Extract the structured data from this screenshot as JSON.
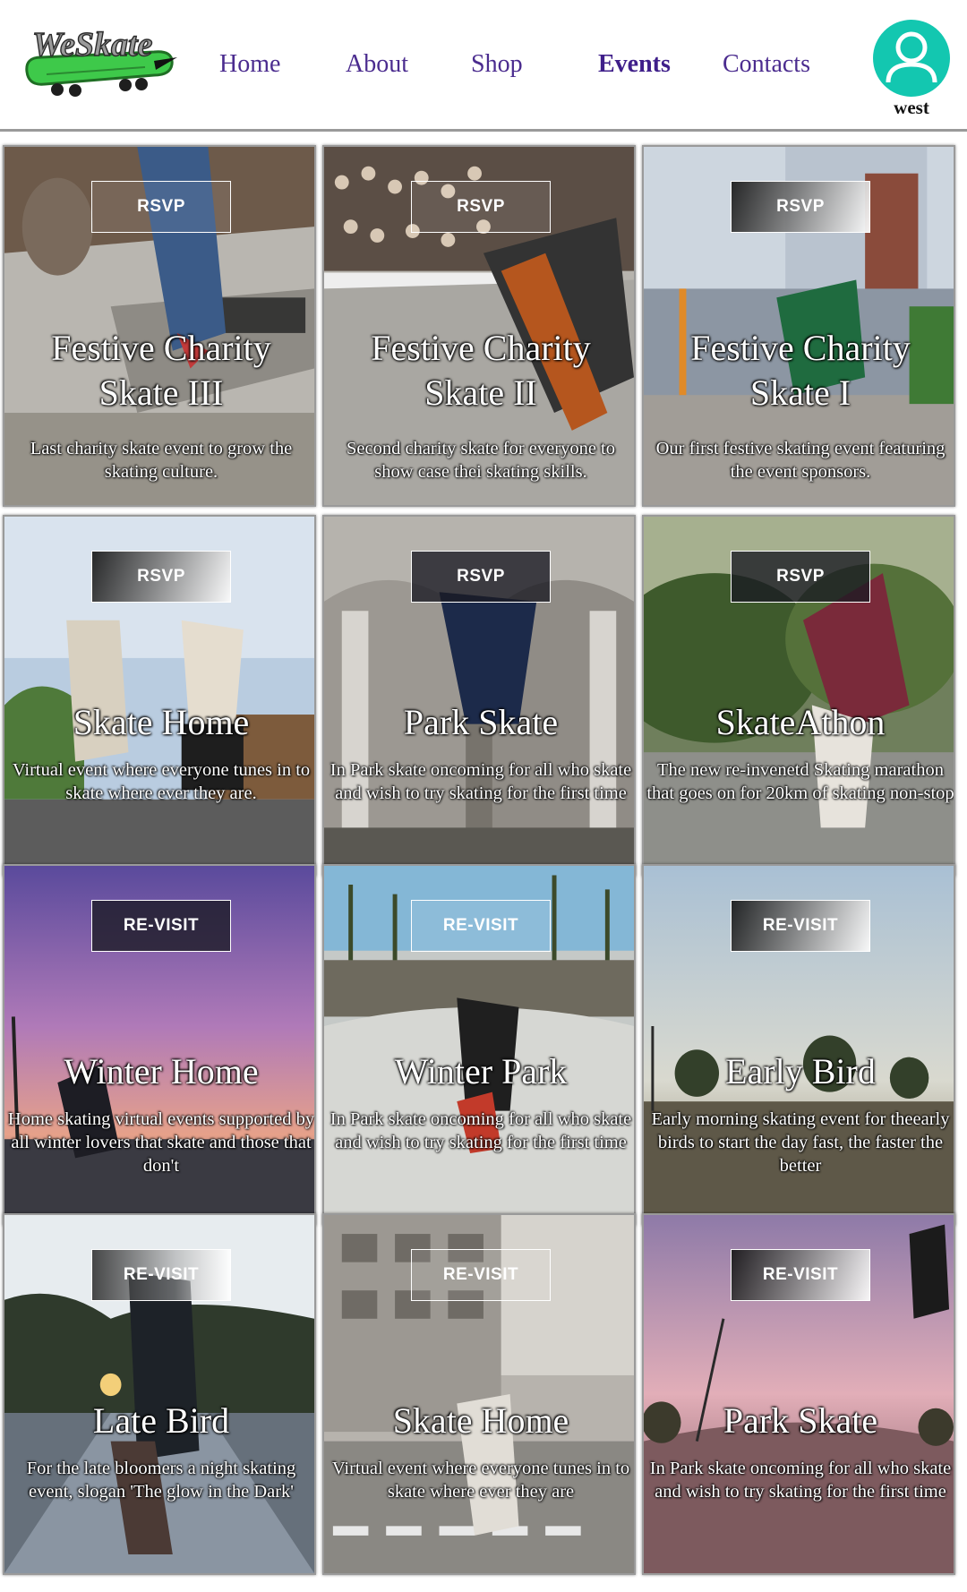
{
  "header": {
    "logo_text": "WeSkate",
    "nav": [
      {
        "label": "Home",
        "active": false
      },
      {
        "label": "About",
        "active": false
      },
      {
        "label": "Shop",
        "active": false
      },
      {
        "label": "Events",
        "active": true
      },
      {
        "label": "Contacts",
        "active": false
      }
    ],
    "user": {
      "icon": "user-icon",
      "name": "west",
      "accent": "#13c7b0"
    }
  },
  "colors": {
    "nav_text": "#4b2c8f",
    "header_rule": "#9a9a9a"
  },
  "events": [
    {
      "button": "RSVP",
      "title": "Festive Charity Skate III",
      "description": "Last charity skate event to grow the skating culture.",
      "scene": "skatepark-concrete"
    },
    {
      "button": "RSVP",
      "title": "Festive Charity Skate II",
      "description": "Second charity skate for everyone to show case thei skating skills.",
      "scene": "vans-bowl-crowd"
    },
    {
      "button": "RSVP",
      "title": "Festive Charity Skate I",
      "description": "Our first festive skating event featuring the event sponsors.",
      "scene": "city-gate"
    },
    {
      "button": "RSVP",
      "title": "Skate Home",
      "description": "Virtual event where everyone tunes in to skate where ever they are.",
      "scene": "sky-jump"
    },
    {
      "button": "RSVP",
      "title": "Park Skate",
      "description": "In Park skate oncoming for all who skate and wish to try skating for the first time",
      "scene": "underpass"
    },
    {
      "button": "RSVP",
      "title": "SkateAthon",
      "description": "The new re-invenetd Skating marathon that goes on for 20km of skating non-stop",
      "scene": "trees-street"
    },
    {
      "button": "RE-VISIT",
      "title": "Winter Home",
      "description": "Home skating virtual events supported by all winter lovers that skate and those that don't",
      "scene": "purple-sunset"
    },
    {
      "button": "RE-VISIT",
      "title": "Winter Park",
      "description": "In Park skate oncoming for all who skate and wish to try skating for the first time",
      "scene": "beach-bowl"
    },
    {
      "button": "RE-VISIT",
      "title": "Early Bird",
      "description": "Early morning skating event for theearly birds to start the day fast, the faster the better",
      "scene": "palm-dawn"
    },
    {
      "button": "RE-VISIT",
      "title": "Late Bird",
      "description": "For the late bloomers a night skating event, slogan 'The glow in the Dark'",
      "scene": "road-sunset"
    },
    {
      "button": "RE-VISIT",
      "title": "Skate Home",
      "description": "Virtual event where everyone tunes in to skate where ever they are",
      "scene": "city-crosswalk"
    },
    {
      "button": "RE-VISIT",
      "title": "Park Skate",
      "description": "In Park skate oncoming for all who skate and wish to try skating for the first time",
      "scene": "pink-sky"
    }
  ]
}
